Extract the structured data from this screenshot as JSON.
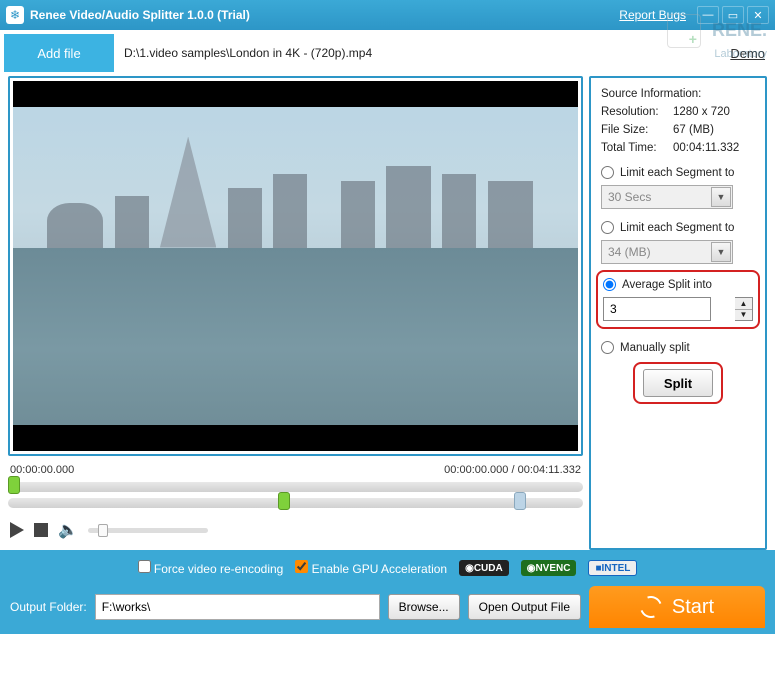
{
  "titlebar": {
    "app_title": "Renee Video/Audio Splitter 1.0.0 (Trial)",
    "report_bugs": "Report Bugs"
  },
  "watermark": {
    "brand": "RENE.",
    "sub": "Laboratory"
  },
  "topbar": {
    "add_file": "Add file",
    "file_path": "D:\\1.video samples\\London in 4K - (720p).mp4",
    "demo": "Demo"
  },
  "preview": {
    "start_time": "00:00:00.000",
    "position": "00:00:00.000",
    "total": "00:04:11.332"
  },
  "source": {
    "heading": "Source Information:",
    "resolution_label": "Resolution:",
    "resolution": "1280 x 720",
    "filesize_label": "File Size:",
    "filesize": "67 (MB)",
    "totaltime_label": "Total Time:",
    "totaltime": "00:04:11.332"
  },
  "options": {
    "limit_time_label": "Limit each Segment to",
    "limit_time_value": "30 Secs",
    "limit_size_label": "Limit each Segment to",
    "limit_size_value": "34 (MB)",
    "avg_split_label": "Average Split into",
    "avg_split_value": "3",
    "manual_label": "Manually split",
    "split_button": "Split"
  },
  "gpu": {
    "force_label": "Force video re-encoding",
    "enable_label": "Enable GPU Acceleration",
    "cuda": "CUDA",
    "nvenc": "NVENC",
    "intel": "INTEL"
  },
  "output": {
    "label": "Output Folder:",
    "path": "F:\\works\\",
    "browse": "Browse...",
    "open": "Open Output File",
    "start": "Start"
  }
}
